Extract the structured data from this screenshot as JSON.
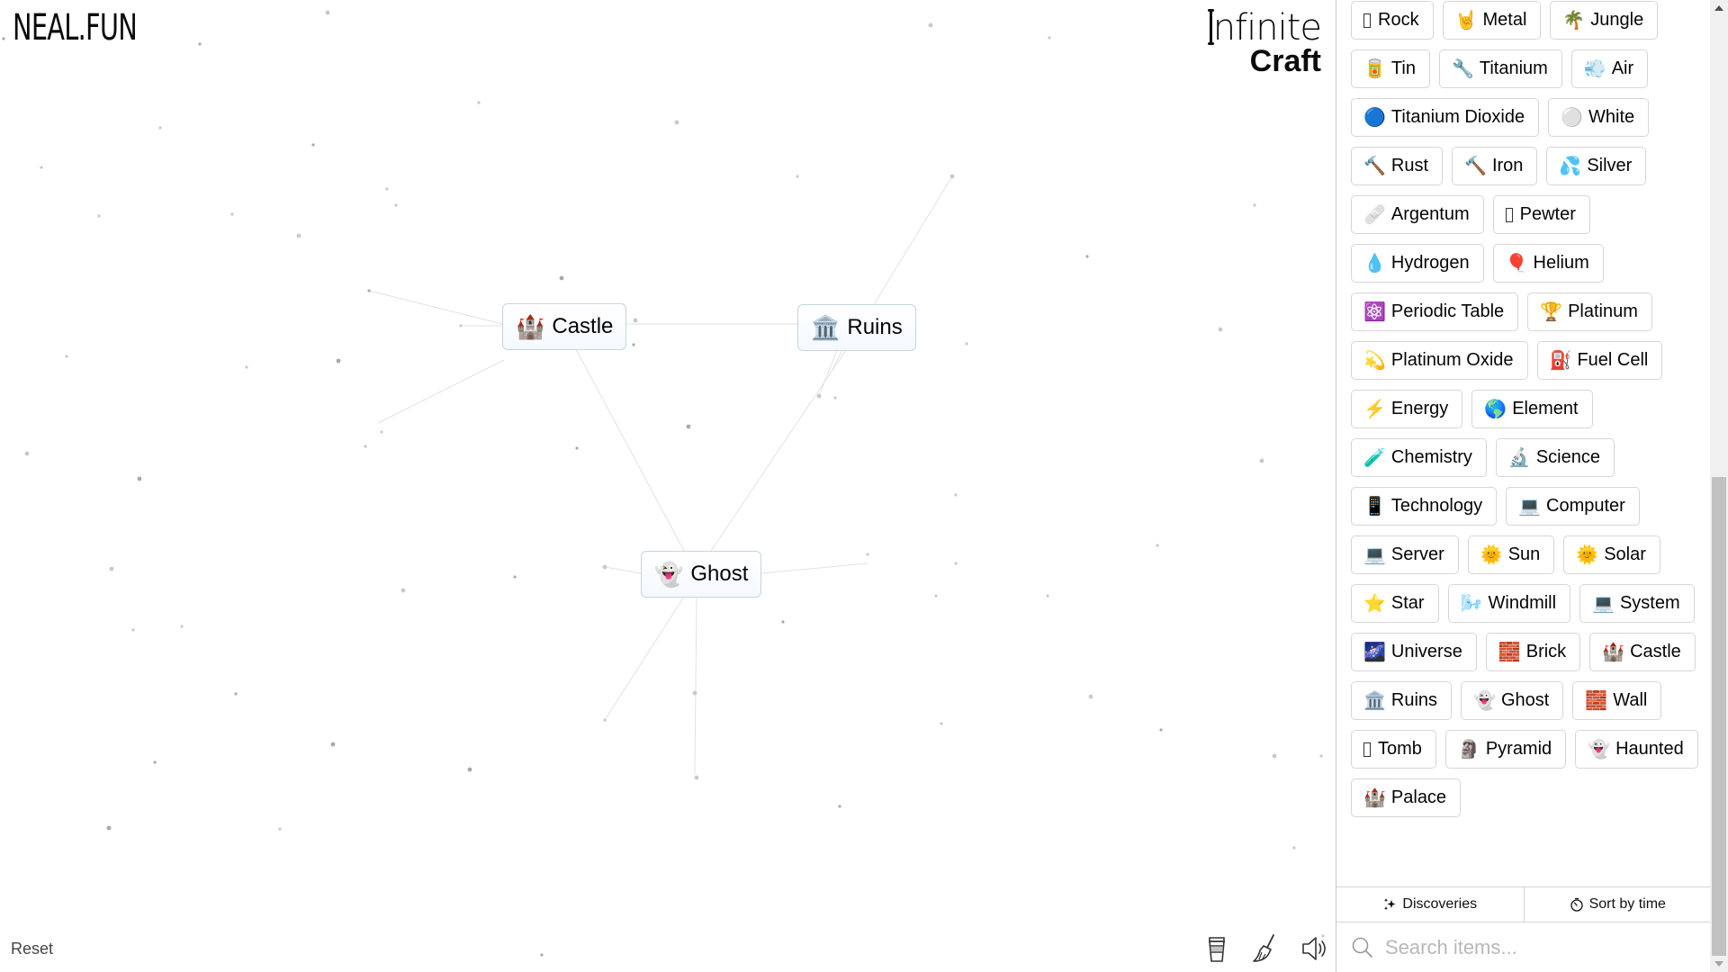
{
  "header": {
    "brand_logo": "NEAL.FUN",
    "app_title_line1": "nfinite",
    "app_title_line2": "Craft"
  },
  "canvas": {
    "nodes": [
      {
        "label": "Castle",
        "emoji": "🏰"
      },
      {
        "label": "Ruins",
        "emoji": "🏛️"
      },
      {
        "label": "Ghost",
        "emoji": "👻"
      }
    ],
    "reset_label": "Reset",
    "tools": [
      {
        "name": "coffee-cup-icon",
        "label": "Donate"
      },
      {
        "name": "broom-icon",
        "label": "Clear"
      },
      {
        "name": "speaker-icon",
        "label": "Sound"
      }
    ]
  },
  "sidebar": {
    "items": [
      {
        "label": "Rock",
        "emoji": ""
      },
      {
        "label": "Metal",
        "emoji": "🤘"
      },
      {
        "label": "Jungle",
        "emoji": "🌴"
      },
      {
        "label": "Tin",
        "emoji": "🥫"
      },
      {
        "label": "Titanium",
        "emoji": "🔧"
      },
      {
        "label": "Air",
        "emoji": "💨"
      },
      {
        "label": "Titanium Dioxide",
        "emoji": "🔵"
      },
      {
        "label": "White",
        "emoji": "⚪"
      },
      {
        "label": "Rust",
        "emoji": "🔨"
      },
      {
        "label": "Iron",
        "emoji": "🔨"
      },
      {
        "label": "Silver",
        "emoji": "💦"
      },
      {
        "label": "Argentum",
        "emoji": "🩹"
      },
      {
        "label": "Pewter",
        "emoji": ""
      },
      {
        "label": "Hydrogen",
        "emoji": "💧"
      },
      {
        "label": "Helium",
        "emoji": "🎈"
      },
      {
        "label": "Periodic Table",
        "emoji": "⚛️"
      },
      {
        "label": "Platinum",
        "emoji": "🏆"
      },
      {
        "label": "Platinum Oxide",
        "emoji": "💫"
      },
      {
        "label": "Fuel Cell",
        "emoji": "⛽"
      },
      {
        "label": "Energy",
        "emoji": "⚡"
      },
      {
        "label": "Element",
        "emoji": "🌎"
      },
      {
        "label": "Chemistry",
        "emoji": "🧪"
      },
      {
        "label": "Science",
        "emoji": "🔬"
      },
      {
        "label": "Technology",
        "emoji": "📱"
      },
      {
        "label": "Computer",
        "emoji": "💻"
      },
      {
        "label": "Server",
        "emoji": "💻"
      },
      {
        "label": "Sun",
        "emoji": "🌞"
      },
      {
        "label": "Solar",
        "emoji": "🌞"
      },
      {
        "label": "Star",
        "emoji": "⭐"
      },
      {
        "label": "Windmill",
        "emoji": "🌬️"
      },
      {
        "label": "System",
        "emoji": "💻"
      },
      {
        "label": "Universe",
        "emoji": "🌌"
      },
      {
        "label": "Brick",
        "emoji": "🧱"
      },
      {
        "label": "Castle",
        "emoji": "🏰"
      },
      {
        "label": "Ruins",
        "emoji": "🏛️"
      },
      {
        "label": "Ghost",
        "emoji": "👻"
      },
      {
        "label": "Wall",
        "emoji": "🧱"
      },
      {
        "label": "Tomb",
        "emoji": ""
      },
      {
        "label": "Pyramid",
        "emoji": "🗿"
      },
      {
        "label": "Haunted",
        "emoji": "👻"
      },
      {
        "label": "Palace",
        "emoji": "🏰"
      }
    ],
    "discoveries_label": "Discoveries",
    "sort_label": "Sort by time",
    "search_placeholder": "Search items...",
    "search_value": ""
  },
  "scrollbar": {
    "position_fraction": 0.49
  }
}
